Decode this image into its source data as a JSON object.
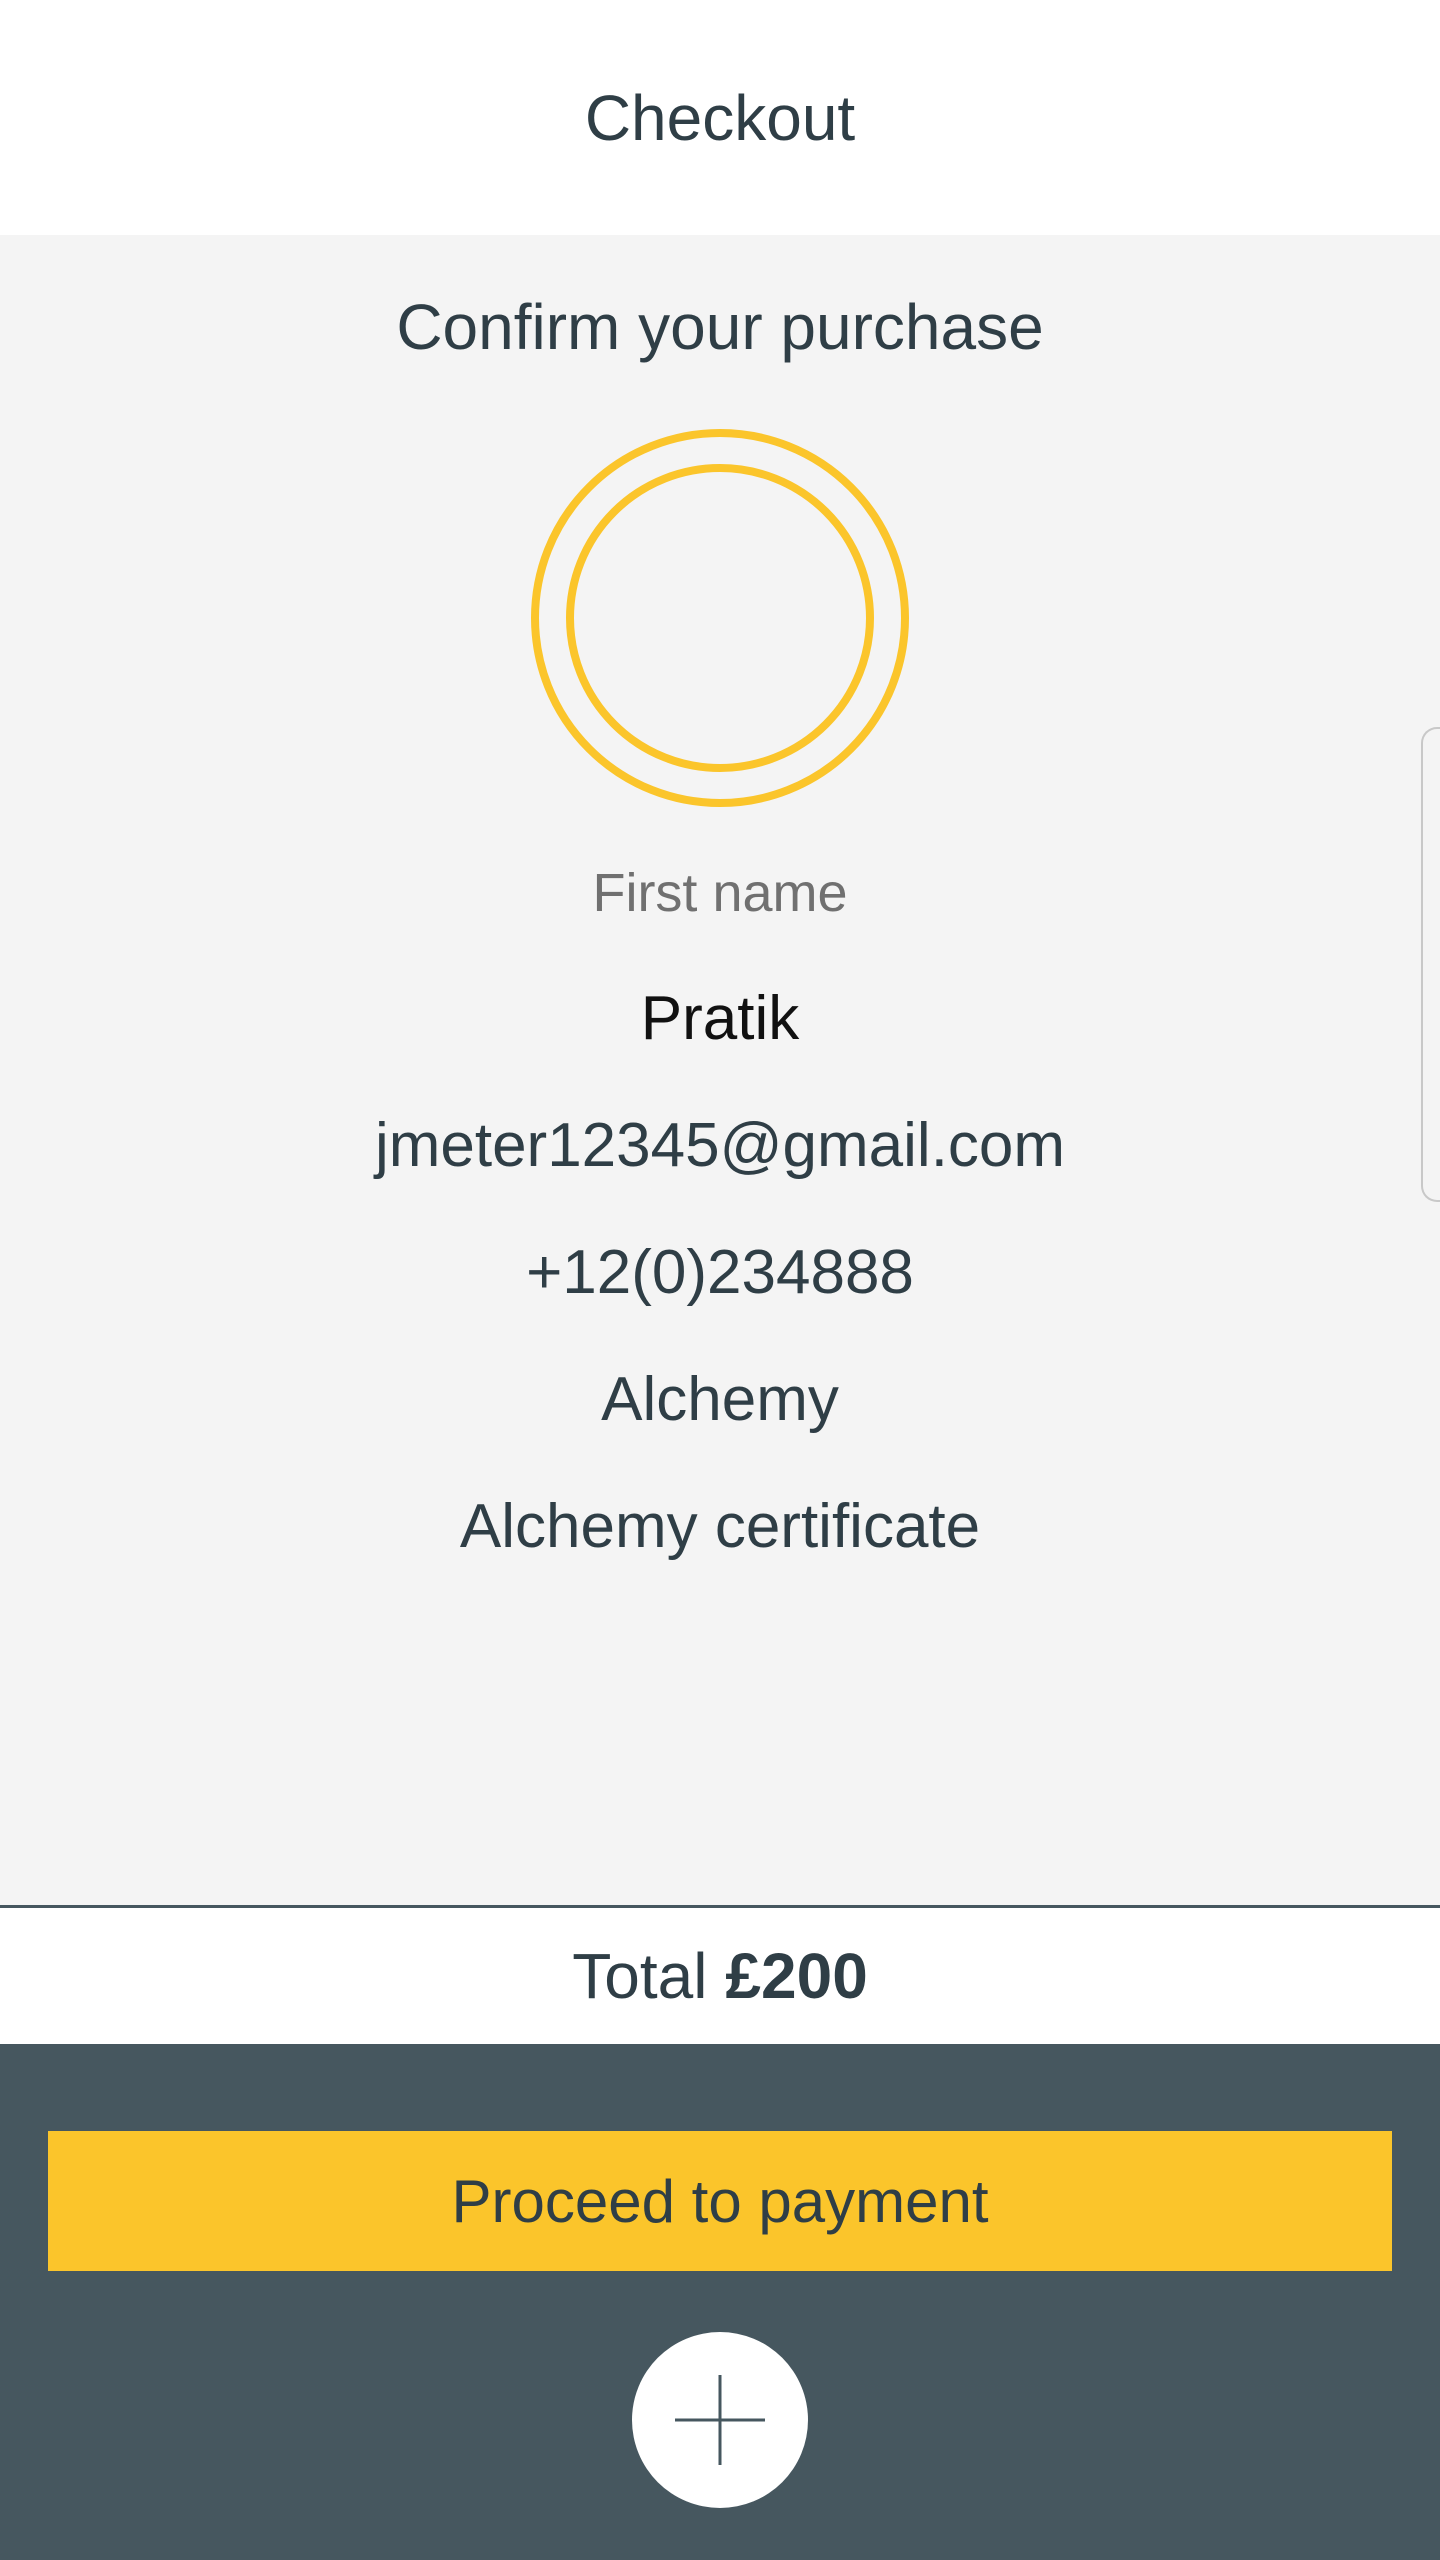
{
  "header": {
    "title": "Checkout"
  },
  "main": {
    "heading": "Confirm your purchase",
    "avatar": {
      "icon": "avatar-ring-icon",
      "ring_color": "#fbc52b"
    },
    "first_name_label": "First name",
    "first_name": "Pratik",
    "email": "jmeter12345@gmail.com",
    "phone": "+12(0)234888",
    "course": "Alchemy",
    "certificate": "Alchemy certificate"
  },
  "total": {
    "label": "Total",
    "amount": "£200"
  },
  "footer": {
    "pay_button_label": "Proceed to payment",
    "add_icon": "plus-icon"
  },
  "colors": {
    "accent": "#fbc52b",
    "dark": "#46575f",
    "text": "#2f3e46",
    "background": "#f4f4f4"
  }
}
